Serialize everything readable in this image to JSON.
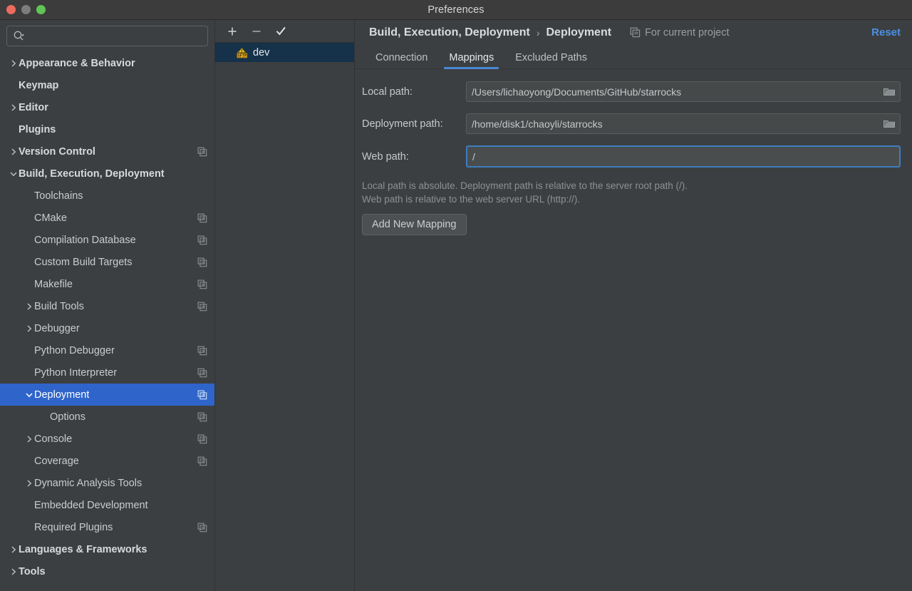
{
  "window": {
    "title": "Preferences",
    "controls": [
      {
        "name": "close",
        "color": "#ec6b5e"
      },
      {
        "name": "minimize",
        "color": "#7d7d7d"
      },
      {
        "name": "maximize",
        "color": "#61c555"
      }
    ]
  },
  "sidebar": {
    "search": {
      "value": "",
      "placeholder": "",
      "icon": "search-icon"
    },
    "items": [
      {
        "label": "Appearance & Behavior",
        "level": 0,
        "bold": true,
        "arrow": "right",
        "copy": false,
        "selected": false
      },
      {
        "label": "Keymap",
        "level": 0,
        "bold": true,
        "arrow": "none",
        "copy": false,
        "selected": false
      },
      {
        "label": "Editor",
        "level": 0,
        "bold": true,
        "arrow": "right",
        "copy": false,
        "selected": false
      },
      {
        "label": "Plugins",
        "level": 0,
        "bold": true,
        "arrow": "none",
        "copy": false,
        "selected": false
      },
      {
        "label": "Version Control",
        "level": 0,
        "bold": true,
        "arrow": "right",
        "copy": true,
        "selected": false
      },
      {
        "label": "Build, Execution, Deployment",
        "level": 0,
        "bold": true,
        "arrow": "down",
        "copy": false,
        "selected": false
      },
      {
        "label": "Toolchains",
        "level": 1,
        "bold": false,
        "arrow": "none",
        "copy": false,
        "selected": false
      },
      {
        "label": "CMake",
        "level": 1,
        "bold": false,
        "arrow": "none",
        "copy": true,
        "selected": false
      },
      {
        "label": "Compilation Database",
        "level": 1,
        "bold": false,
        "arrow": "none",
        "copy": true,
        "selected": false
      },
      {
        "label": "Custom Build Targets",
        "level": 1,
        "bold": false,
        "arrow": "none",
        "copy": true,
        "selected": false
      },
      {
        "label": "Makefile",
        "level": 1,
        "bold": false,
        "arrow": "none",
        "copy": true,
        "selected": false
      },
      {
        "label": "Build Tools",
        "level": 1,
        "bold": false,
        "arrow": "right",
        "copy": true,
        "selected": false
      },
      {
        "label": "Debugger",
        "level": 1,
        "bold": false,
        "arrow": "right",
        "copy": false,
        "selected": false
      },
      {
        "label": "Python Debugger",
        "level": 1,
        "bold": false,
        "arrow": "none",
        "copy": true,
        "selected": false
      },
      {
        "label": "Python Interpreter",
        "level": 1,
        "bold": false,
        "arrow": "none",
        "copy": true,
        "selected": false
      },
      {
        "label": "Deployment",
        "level": 1,
        "bold": false,
        "arrow": "down",
        "copy": true,
        "selected": true
      },
      {
        "label": "Options",
        "level": 2,
        "bold": false,
        "arrow": "none",
        "copy": true,
        "selected": false
      },
      {
        "label": "Console",
        "level": 1,
        "bold": false,
        "arrow": "right",
        "copy": true,
        "selected": false
      },
      {
        "label": "Coverage",
        "level": 1,
        "bold": false,
        "arrow": "none",
        "copy": true,
        "selected": false
      },
      {
        "label": "Dynamic Analysis Tools",
        "level": 1,
        "bold": false,
        "arrow": "right",
        "copy": false,
        "selected": false
      },
      {
        "label": "Embedded Development",
        "level": 1,
        "bold": false,
        "arrow": "none",
        "copy": false,
        "selected": false
      },
      {
        "label": "Required Plugins",
        "level": 1,
        "bold": false,
        "arrow": "none",
        "copy": true,
        "selected": false
      },
      {
        "label": "Languages & Frameworks",
        "level": 0,
        "bold": true,
        "arrow": "right",
        "copy": false,
        "selected": false
      },
      {
        "label": "Tools",
        "level": 0,
        "bold": true,
        "arrow": "right",
        "copy": false,
        "selected": false
      }
    ]
  },
  "server_panel": {
    "toolbar": [
      {
        "name": "add-server-button",
        "glyph": "+"
      },
      {
        "name": "remove-server-button",
        "glyph": "−"
      },
      {
        "name": "set-default-button",
        "glyph": "✓"
      }
    ],
    "servers": [
      {
        "label": "dev",
        "icon": "sftp-icon",
        "selected": true
      }
    ]
  },
  "header": {
    "breadcrumb_root": "Build, Execution, Deployment",
    "breadcrumb_sep": "›",
    "breadcrumb_leaf": "Deployment",
    "for_current_project": "For current project",
    "for_current_project_icon": "copy-scope-icon",
    "reset_label": "Reset",
    "reset_color": "#4a90e2"
  },
  "tabs": [
    {
      "label": "Connection",
      "active": false
    },
    {
      "label": "Mappings",
      "active": true
    },
    {
      "label": "Excluded Paths",
      "active": false
    }
  ],
  "mappings": {
    "fields": [
      {
        "label": "Local path:",
        "value": "/Users/lichaoyong/Documents/GitHub/starrocks",
        "browse": true,
        "focused": false
      },
      {
        "label": "Deployment path:",
        "value": "/home/disk1/chaoyli/starrocks",
        "browse": true,
        "focused": false
      },
      {
        "label": "Web path:",
        "value": "/",
        "browse": false,
        "focused": true
      }
    ],
    "hint_line1": "Local path is absolute. Deployment path is relative to the server root path (/).",
    "hint_line2": "Web path is relative to the web server URL (http://).",
    "add_mapping_label": "Add New Mapping"
  },
  "colors": {
    "accent": "#4a88d4",
    "selection": "#2f65ca",
    "list_selection": "#15324a",
    "background": "#3c3f41",
    "sftp_badge": "#d9a521"
  }
}
